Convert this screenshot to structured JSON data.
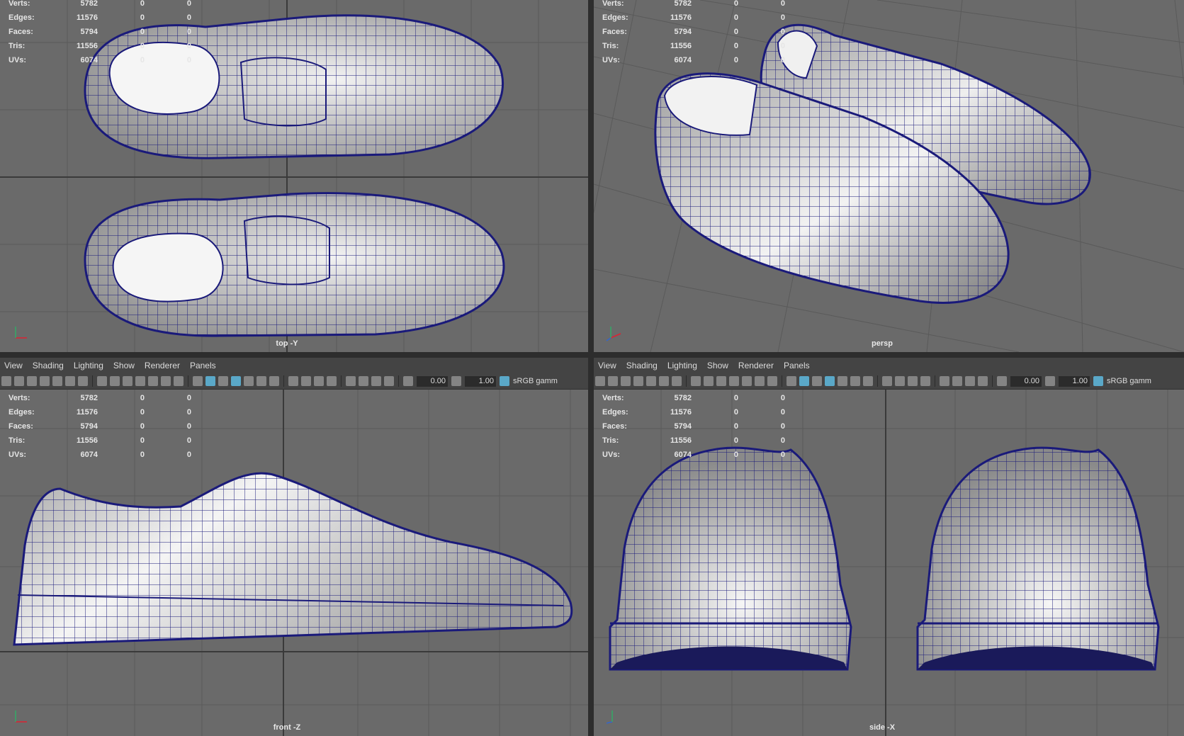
{
  "menu": [
    "View",
    "Shading",
    "Lighting",
    "Show",
    "Renderer",
    "Panels"
  ],
  "toolbar": {
    "field_a": "0.00",
    "field_b": "1.00",
    "color_space": "sRGB gamm"
  },
  "hud": {
    "labels": [
      "Verts:",
      "Edges:",
      "Faces:",
      "Tris:",
      "UVs:"
    ],
    "v1": [
      "5782",
      "11576",
      "5794",
      "11556",
      "6074"
    ],
    "v2": [
      "0",
      "0",
      "0",
      "0",
      "0"
    ],
    "v3": [
      "0",
      "0",
      "0",
      "0",
      "0"
    ]
  },
  "cameras": {
    "top": "top -Y",
    "persp": "persp",
    "front": "front -Z",
    "side": "side -X"
  },
  "colors": {
    "viewport_bg": "#6a6a6a",
    "grid": "#5a5a5a",
    "wire": "#1a1a7a",
    "ui_bar": "#444444"
  }
}
